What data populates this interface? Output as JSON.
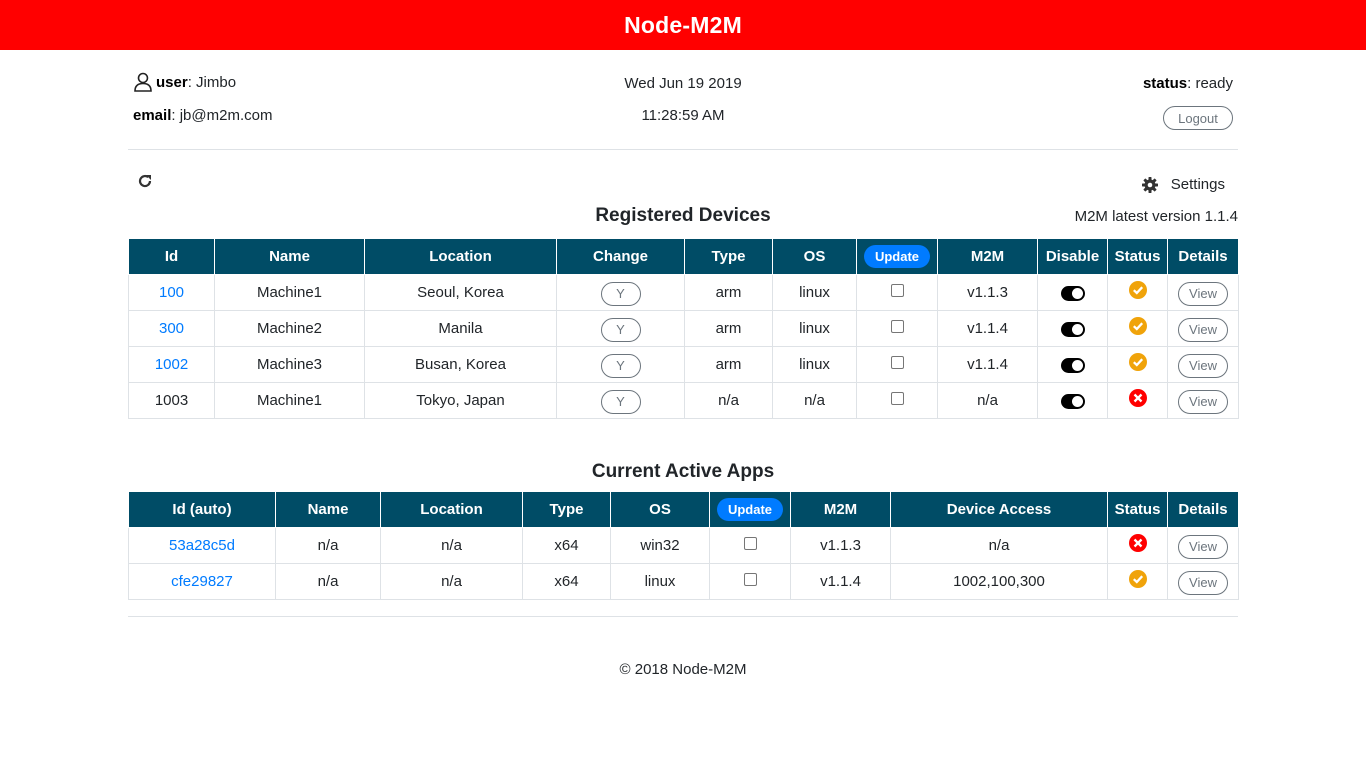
{
  "app": {
    "title": "Node-M2M"
  },
  "user": {
    "label": "user",
    "name": "Jimbo",
    "email_label": "email",
    "email": "jb@m2m.com"
  },
  "clock": {
    "date": "Wed Jun 19 2019",
    "time": "11:28:59 AM"
  },
  "status": {
    "label": "status",
    "value": "ready"
  },
  "logout_label": "Logout",
  "settings_label": "Settings",
  "icons": {
    "user": "user-icon",
    "refresh": "refresh-icon",
    "settings": "gear-icon",
    "online": "check-circle-icon",
    "offline": "x-circle-icon"
  },
  "colors": {
    "header": "#ff0000",
    "table_head": "#004c66",
    "update_pill": "#007bff",
    "link": "#007bff",
    "online": "#f0a30a",
    "offline": "#ff0000"
  },
  "devices": {
    "title": "Registered Devices",
    "latest": "M2M latest version 1.1.4",
    "update_label": "Update",
    "columns": [
      "Id",
      "Name",
      "Location",
      "Change",
      "Type",
      "OS",
      "Update",
      "M2M",
      "Disable",
      "Status",
      "Details"
    ],
    "rows": [
      {
        "id": "100",
        "linked": true,
        "name": "Machine1",
        "location": "Seoul, Korea",
        "change": "Y",
        "type": "arm",
        "os": "linux",
        "m2m": "v1.1.3",
        "disable_on": true,
        "status": "online",
        "details": "View"
      },
      {
        "id": "300",
        "linked": true,
        "name": "Machine2",
        "location": "Manila",
        "change": "Y",
        "type": "arm",
        "os": "linux",
        "m2m": "v1.1.4",
        "disable_on": true,
        "status": "online",
        "details": "View"
      },
      {
        "id": "1002",
        "linked": true,
        "name": "Machine3",
        "location": "Busan, Korea",
        "change": "Y",
        "type": "arm",
        "os": "linux",
        "m2m": "v1.1.4",
        "disable_on": true,
        "status": "online",
        "details": "View"
      },
      {
        "id": "1003",
        "linked": false,
        "name": "Machine1",
        "location": "Tokyo, Japan",
        "change": "Y",
        "type": "n/a",
        "os": "n/a",
        "m2m": "n/a",
        "disable_on": true,
        "status": "offline",
        "details": "View"
      }
    ]
  },
  "apps": {
    "title": "Current Active Apps",
    "update_label": "Update",
    "columns": [
      "Id (auto)",
      "Name",
      "Location",
      "Type",
      "OS",
      "Update",
      "M2M",
      "Device Access",
      "Status",
      "Details"
    ],
    "rows": [
      {
        "id": "53a28c5d",
        "name": "n/a",
        "location": "n/a",
        "type": "x64",
        "os": "win32",
        "m2m": "v1.1.3",
        "access": "n/a",
        "status": "offline",
        "details": "View"
      },
      {
        "id": "cfe29827",
        "name": "n/a",
        "location": "n/a",
        "type": "x64",
        "os": "linux",
        "m2m": "v1.1.4",
        "access": "1002,100,300",
        "status": "online",
        "details": "View"
      }
    ]
  },
  "footer": {
    "text": "© 2018 Node-M2M"
  }
}
